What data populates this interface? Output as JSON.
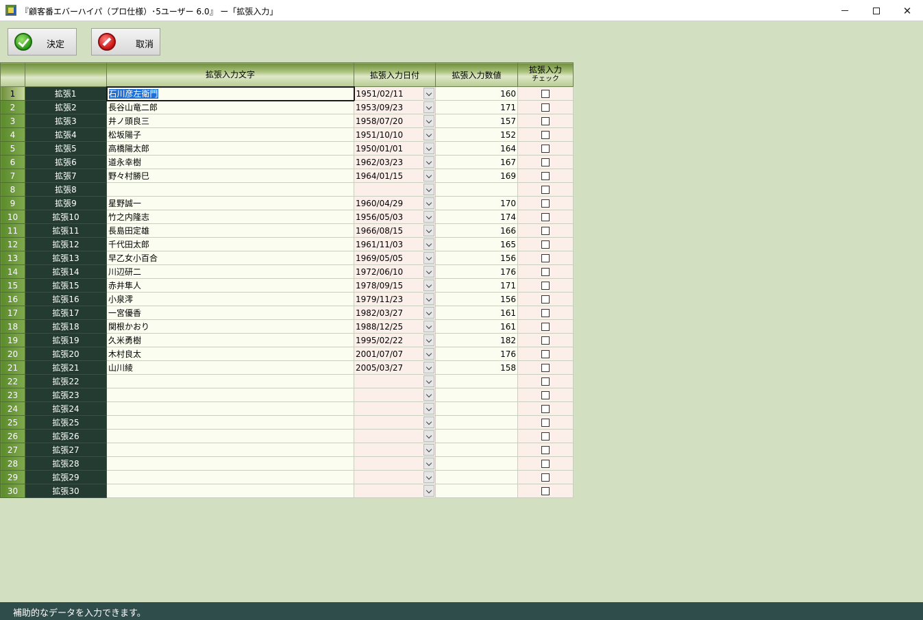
{
  "window": {
    "title": "『顧客番エバーハイパ（プロ仕様）･5ユーザー 6.0』 ー「拡張入力」",
    "icons": {
      "app": "app-icon",
      "minimize": "minimize-icon",
      "maximize": "maximize-icon",
      "close": "close-icon"
    }
  },
  "toolbar": {
    "ok_label": "決定",
    "cancel_label": "取消",
    "ok_icon": "check-circle-icon",
    "cancel_icon": "no-entry-icon"
  },
  "grid": {
    "headers": {
      "number": "",
      "label": "",
      "text": "拡張入力文字",
      "date": "拡張入力日付",
      "value": "拡張入力数値",
      "check_line1": "拡張入力",
      "check_line2": "チェック"
    },
    "rows": [
      {
        "no": "1",
        "label": "拡張1",
        "text": "石川彦左衛門",
        "date": "1951/02/11",
        "value": "160",
        "checked": false
      },
      {
        "no": "2",
        "label": "拡張2",
        "text": "長谷山竜二郎",
        "date": "1953/09/23",
        "value": "171",
        "checked": false
      },
      {
        "no": "3",
        "label": "拡張3",
        "text": "井ノ頭良三",
        "date": "1958/07/20",
        "value": "157",
        "checked": false
      },
      {
        "no": "4",
        "label": "拡張4",
        "text": "松坂陽子",
        "date": "1951/10/10",
        "value": "152",
        "checked": false
      },
      {
        "no": "5",
        "label": "拡張5",
        "text": "高橋陽太郎",
        "date": "1950/01/01",
        "value": "164",
        "checked": false
      },
      {
        "no": "6",
        "label": "拡張6",
        "text": "道永幸樹",
        "date": "1962/03/23",
        "value": "167",
        "checked": false
      },
      {
        "no": "7",
        "label": "拡張7",
        "text": "野々村勝巳",
        "date": "1964/01/15",
        "value": "169",
        "checked": false
      },
      {
        "no": "8",
        "label": "拡張8",
        "text": "",
        "date": "",
        "value": "",
        "checked": false
      },
      {
        "no": "9",
        "label": "拡張9",
        "text": "星野誠一",
        "date": "1960/04/29",
        "value": "170",
        "checked": false
      },
      {
        "no": "10",
        "label": "拡張10",
        "text": "竹之内隆志",
        "date": "1956/05/03",
        "value": "174",
        "checked": false
      },
      {
        "no": "11",
        "label": "拡張11",
        "text": "長島田定雄",
        "date": "1966/08/15",
        "value": "166",
        "checked": false
      },
      {
        "no": "12",
        "label": "拡張12",
        "text": "千代田太郎",
        "date": "1961/11/03",
        "value": "165",
        "checked": false
      },
      {
        "no": "13",
        "label": "拡張13",
        "text": "早乙女小百合",
        "date": "1969/05/05",
        "value": "156",
        "checked": false
      },
      {
        "no": "14",
        "label": "拡張14",
        "text": "川辺研二",
        "date": "1972/06/10",
        "value": "176",
        "checked": false
      },
      {
        "no": "15",
        "label": "拡張15",
        "text": "赤井隼人",
        "date": "1978/09/15",
        "value": "171",
        "checked": false
      },
      {
        "no": "16",
        "label": "拡張16",
        "text": "小泉澪",
        "date": "1979/11/23",
        "value": "156",
        "checked": false
      },
      {
        "no": "17",
        "label": "拡張17",
        "text": "一宮優香",
        "date": "1982/03/27",
        "value": "161",
        "checked": false
      },
      {
        "no": "18",
        "label": "拡張18",
        "text": "関根かおり",
        "date": "1988/12/25",
        "value": "161",
        "checked": false
      },
      {
        "no": "19",
        "label": "拡張19",
        "text": "久米勇樹",
        "date": "1995/02/22",
        "value": "182",
        "checked": false
      },
      {
        "no": "20",
        "label": "拡張20",
        "text": "木村良太",
        "date": "2001/07/07",
        "value": "176",
        "checked": false
      },
      {
        "no": "21",
        "label": "拡張21",
        "text": "山川綾",
        "date": "2005/03/27",
        "value": "158",
        "checked": false
      },
      {
        "no": "22",
        "label": "拡張22",
        "text": "",
        "date": "",
        "value": "",
        "checked": false
      },
      {
        "no": "23",
        "label": "拡張23",
        "text": "",
        "date": "",
        "value": "",
        "checked": false
      },
      {
        "no": "24",
        "label": "拡張24",
        "text": "",
        "date": "",
        "value": "",
        "checked": false
      },
      {
        "no": "25",
        "label": "拡張25",
        "text": "",
        "date": "",
        "value": "",
        "checked": false
      },
      {
        "no": "26",
        "label": "拡張26",
        "text": "",
        "date": "",
        "value": "",
        "checked": false
      },
      {
        "no": "27",
        "label": "拡張27",
        "text": "",
        "date": "",
        "value": "",
        "checked": false
      },
      {
        "no": "28",
        "label": "拡張28",
        "text": "",
        "date": "",
        "value": "",
        "checked": false
      },
      {
        "no": "29",
        "label": "拡張29",
        "text": "",
        "date": "",
        "value": "",
        "checked": false
      },
      {
        "no": "30",
        "label": "拡張30",
        "text": "",
        "date": "",
        "value": "",
        "checked": false
      }
    ],
    "selected_row": 1
  },
  "status": {
    "text": "補助的なデータを入力できます。"
  },
  "colors": {
    "background": "#d3dfc1",
    "label_column": "#243b32",
    "status_bar": "#2f4d4a",
    "text_cell": "#fafdef",
    "date_cell": "#fcefe9"
  }
}
